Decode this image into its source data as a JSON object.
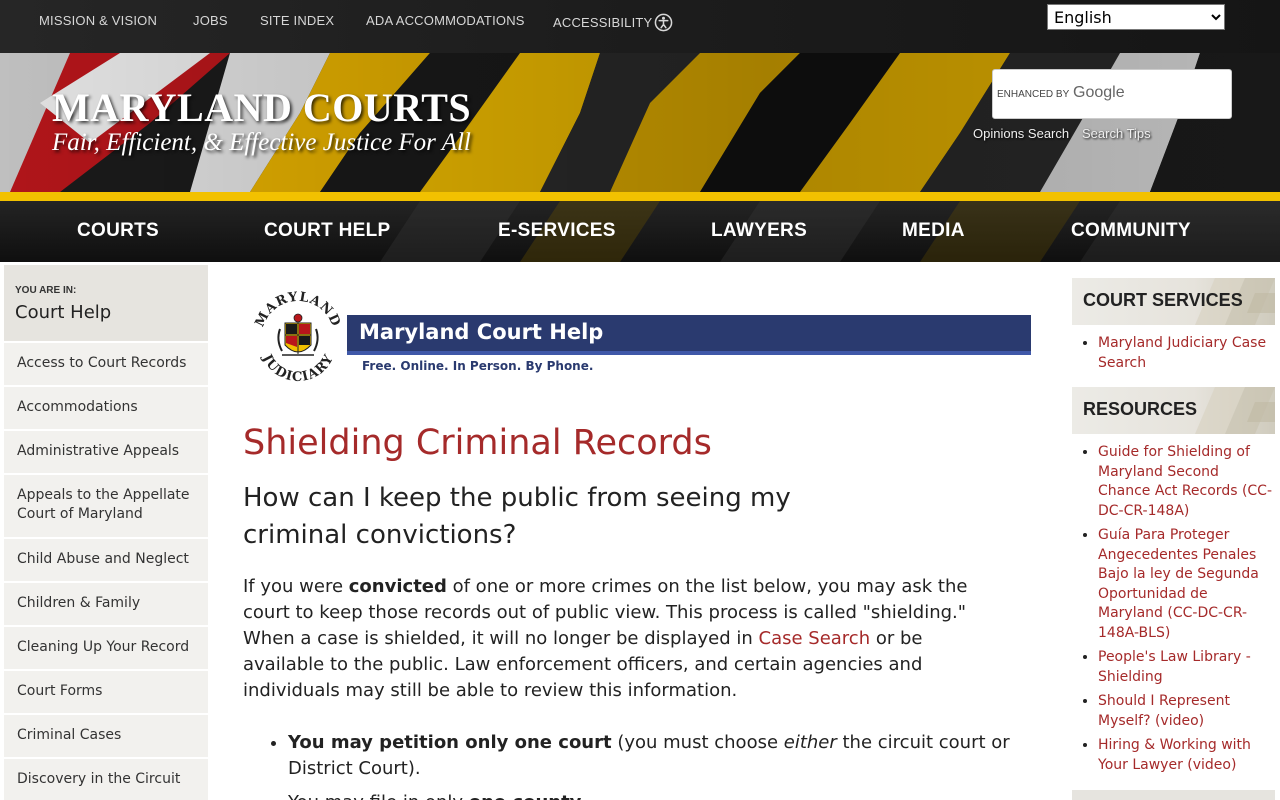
{
  "utility_nav": {
    "items": [
      "MISSION & VISION",
      "JOBS",
      "SITE INDEX",
      "ADA ACCOMMODATIONS",
      "ACCESSIBILITY"
    ],
    "accessibility_icon": "accessibility-icon"
  },
  "language": {
    "selected": "English"
  },
  "header": {
    "title": "MARYLAND COURTS",
    "tagline": "Fair, Efficient, & Effective Justice For All",
    "search_enhanced": "ENHANCED BY",
    "search_brand": "Google",
    "links": [
      "Opinions Search",
      "Search Tips"
    ]
  },
  "main_nav": [
    "COURTS",
    "COURT HELP",
    "E-SERVICES",
    "LAWYERS",
    "MEDIA",
    "COMMUNITY"
  ],
  "sidebar": {
    "you_are_in_label": "YOU ARE IN:",
    "current": "Court Help",
    "items": [
      "Access to Court Records",
      "Accommodations",
      "Administrative Appeals",
      "Appeals to the Appellate Court of Maryland",
      "Child Abuse and Neglect",
      "Children & Family",
      "Cleaning Up Your Record",
      "Court Forms",
      "Criminal Cases",
      "Discovery in the Circuit"
    ]
  },
  "logo": {
    "seal_top": "MARYLAND",
    "seal_bottom": "JUDICIARY",
    "banner_title": "Maryland Court Help",
    "banner_sub": "Free. Online. In Person. By Phone."
  },
  "content": {
    "title": "Shielding Criminal Records",
    "subtitle": "How can I keep the public from seeing my criminal convictions?",
    "intro_1": "If you were ",
    "intro_bold": "convicted",
    "intro_2": " of one or more crimes on the list below, you may ask the court to keep those records out of public view. This process is called \"shielding.\" When a case is shielded, it will no longer be displayed in ",
    "intro_link": "Case Search",
    "intro_3": " or be available to the public. Law enforcement officers, and certain agencies and individuals may still be able to review this information.",
    "bullet1_bold": "You may petition only one court",
    "bullet1_a": " (you must choose ",
    "bullet1_em": "either",
    "bullet1_b": " the circuit court or District Court).",
    "bullet2_a": "You may file in only ",
    "bullet2_bold": "one county",
    "bullet2_b": "."
  },
  "right_sidebar": {
    "court_services_title": "COURT SERVICES",
    "court_services": [
      "Maryland Judiciary Case Search"
    ],
    "resources_title": "RESOURCES",
    "resources": [
      "Guide for Shielding of Maryland Second Chance Act Records (CC-DC-CR-148A)",
      "Guía Para Proteger Angecedentes Penales Bajo la ley de Segunda Oportunidad de Maryland (CC-DC-CR-148A-BLS)",
      "People's Law Library - Shielding",
      "Should I Represent Myself? (video)",
      "Hiring & Working with Your Lawyer (video)"
    ]
  },
  "colors": {
    "accent_red": "#a52a2a",
    "gold": "#f2c100",
    "banner_blue": "#2a3a6f",
    "nav_dark": "#151515"
  }
}
